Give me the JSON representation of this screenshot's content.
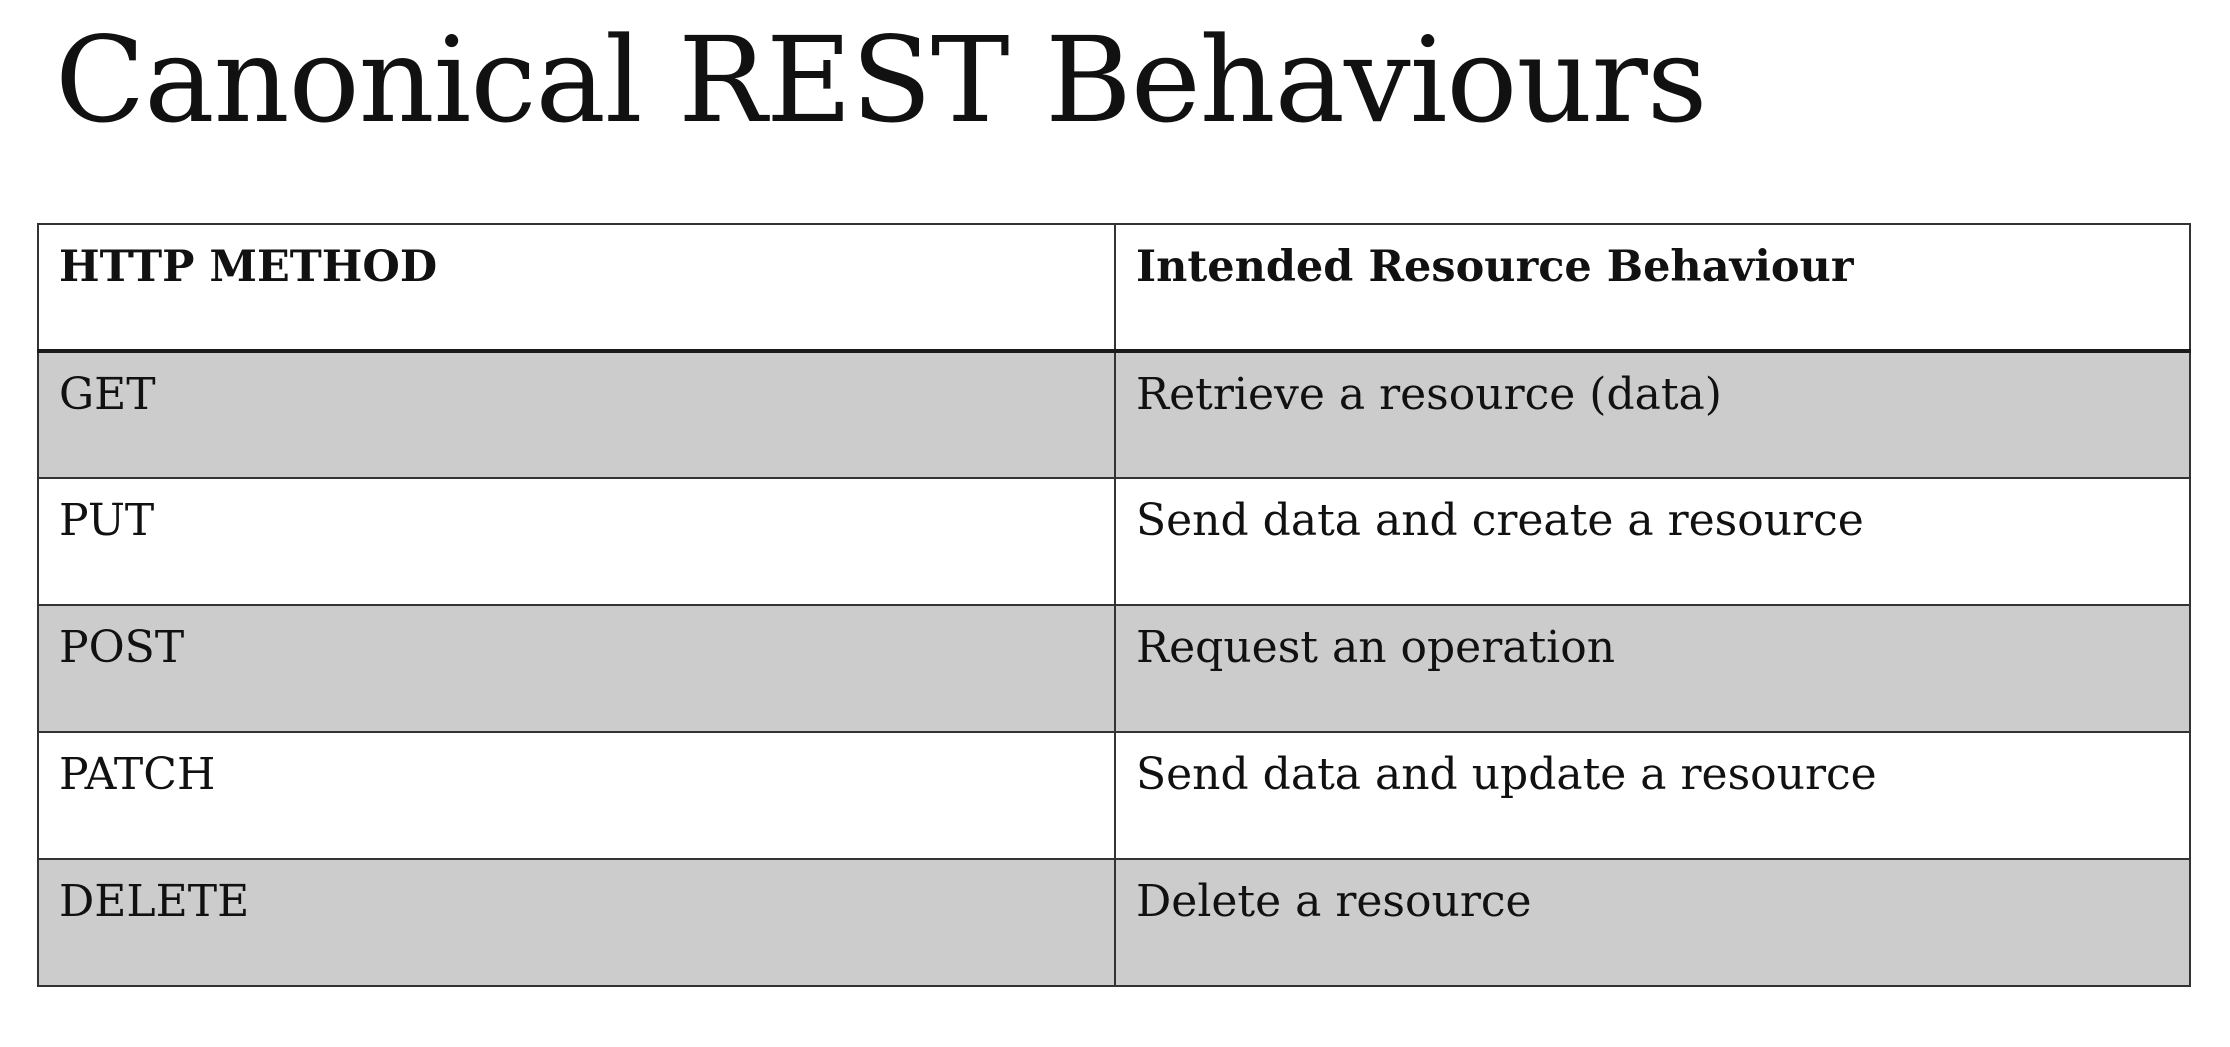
{
  "title": "Canonical REST Behaviours",
  "table": {
    "headers": [
      "HTTP METHOD",
      "Intended Resource Behaviour"
    ],
    "rows": [
      {
        "method": "GET",
        "behaviour": "Retrieve a resource (data)"
      },
      {
        "method": "PUT",
        "behaviour": "Send data and create a resource"
      },
      {
        "method": "POST",
        "behaviour": "Request an operation"
      },
      {
        "method": "PATCH",
        "behaviour": "Send data and update a resource"
      },
      {
        "method": "DELETE",
        "behaviour": "Delete a resource"
      }
    ]
  },
  "colors": {
    "shaded_row": "#cccccc",
    "plain_row": "#ffffff",
    "border": "#333333",
    "text": "#111111"
  }
}
